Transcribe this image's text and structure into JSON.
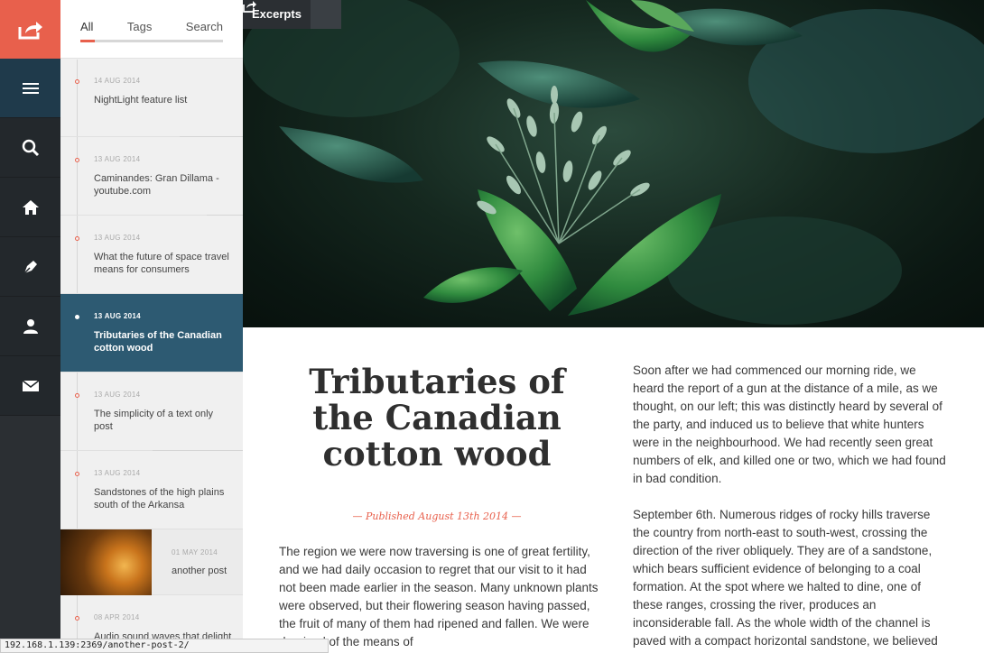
{
  "tabs": [
    "All",
    "Tags",
    "Search"
  ],
  "nav": {
    "items": [
      "share-icon",
      "menu-icon",
      "search-icon",
      "home-icon",
      "pen-icon",
      "user-icon",
      "mail-icon"
    ]
  },
  "posts": [
    {
      "date": "14 AUG 2014",
      "title": "NightLight feature list"
    },
    {
      "date": "13 AUG 2014",
      "title": "Caminandes: Gran Dillama - youtube.com"
    },
    {
      "date": "13 AUG 2014",
      "title": "What the future of space travel means for consumers"
    },
    {
      "date": "13 AUG 2014",
      "title": "Tributaries of the Canadian cotton wood"
    },
    {
      "date": "13 AUG 2014",
      "title": "The simplicity of a text only post"
    },
    {
      "date": "13 AUG 2014",
      "title": "Sandstones of the high plains south of the Arkansa"
    },
    {
      "date": "01 MAY 2014",
      "title": "another post"
    },
    {
      "date": "08 APR 2014",
      "title": "Audio sound waves that delight the ear"
    }
  ],
  "hero": {
    "excerpts_label": "Excerpts"
  },
  "article": {
    "title": "Tributaries of the Canadian cotton wood",
    "published": "— Published August 13th 2014 —",
    "left_text": "The region we were now traversing is one of great fertility, and we had daily occasion to regret that our visit to it had not been made earlier in the season. Many unknown plants were observed, but their flowering season having passed, the fruit of many of them had ripened and fallen. We were deprived of the means of",
    "right_p1": "Soon after we had commenced our morning ride, we heard the report of a gun at the distance of a mile, as we thought, on our left; this was distinctly heard by several of the party, and induced us to believe that white hunters were in the neighbourhood. We had recently seen great numbers of elk, and killed one or two, which we had found in bad condition.",
    "right_p2": "September 6th. Numerous ridges of rocky hills traverse the country from north-east to south-west, crossing the direction of the river obliquely. They are of a sandstone, which bears sufficient evidence of belonging to a coal formation. At the spot where we halted to dine, one of these ranges, crossing the river, produces an inconsiderable fall. As the whole width of the channel is paved with a compact horizontal sandstone, we believed"
  },
  "statusbar": {
    "url": "192.168.1.139:2369/another-post-2/"
  },
  "colors": {
    "accent": "#e8604c",
    "active_post": "#2d5a72",
    "rail": "#2b2f33"
  }
}
